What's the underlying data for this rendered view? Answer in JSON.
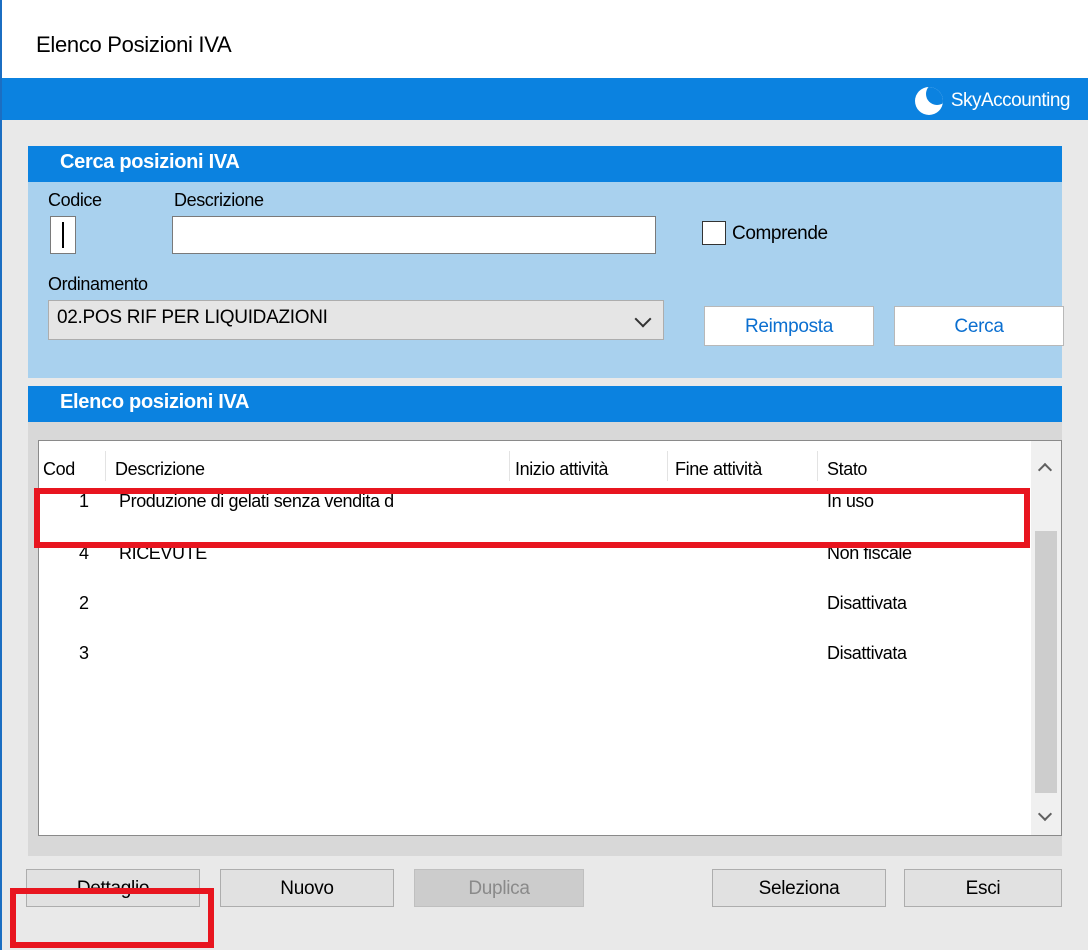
{
  "window": {
    "title": "Elenco Posizioni IVA",
    "brand": "SkyAccounting"
  },
  "search": {
    "header": "Cerca posizioni IVA",
    "codice_label": "Codice",
    "codice_value": "",
    "descrizione_label": "Descrizione",
    "descrizione_value": "",
    "comprende_label": "Comprende",
    "comprende_checked": false,
    "ordinamento_label": "Ordinamento",
    "ordinamento_value": "02.POS RIF PER LIQUIDAZIONI",
    "reimposta_label": "Reimposta",
    "cerca_label": "Cerca"
  },
  "list": {
    "header": "Elenco posizioni IVA",
    "columns": [
      "Cod",
      "Descrizione",
      "Inizio attività",
      "Fine attività",
      "Stato"
    ],
    "rows": [
      {
        "cod": "1",
        "descrizione": "Produzione di gelati senza vendita d",
        "inizio": "",
        "fine": "",
        "stato": "In uso"
      },
      {
        "cod": "4",
        "descrizione": "RICEVUTE",
        "inizio": "",
        "fine": "",
        "stato": "Non fiscale"
      },
      {
        "cod": "2",
        "descrizione": "",
        "inizio": "",
        "fine": "",
        "stato": "Disattivata"
      },
      {
        "cod": "3",
        "descrizione": "",
        "inizio": "",
        "fine": "",
        "stato": "Disattivata"
      }
    ]
  },
  "buttons": {
    "dettaglio": "Dettaglio",
    "nuovo": "Nuovo",
    "duplica": "Duplica",
    "seleziona": "Seleziona",
    "esci": "Esci"
  },
  "colors": {
    "accent": "#0b82e0",
    "search_panel_bg": "#a9d1ee",
    "highlight": "#e8151f"
  }
}
